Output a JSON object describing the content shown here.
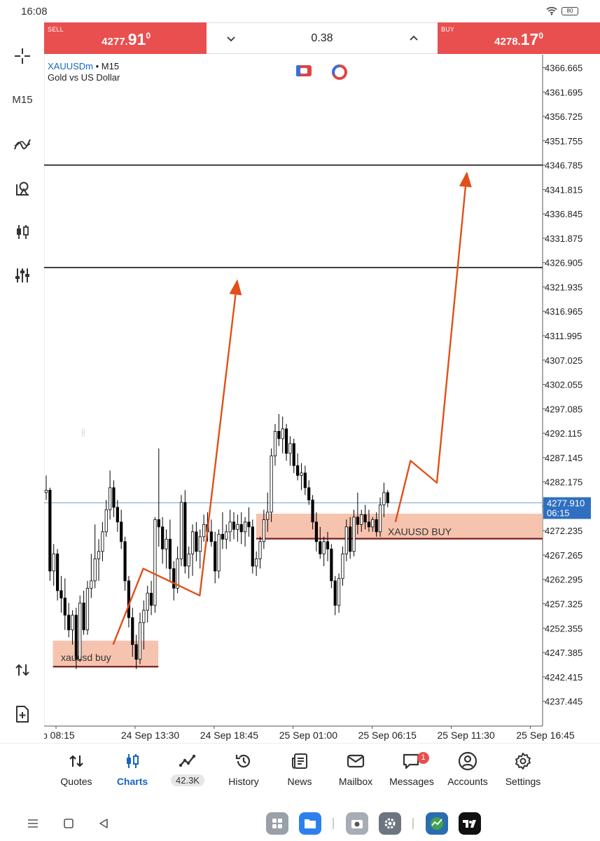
{
  "status_bar": {
    "time": "16:08",
    "battery": "80"
  },
  "trade_panel": {
    "sell": {
      "label": "SELL",
      "price_prefix": "4277.",
      "price_big": "91",
      "price_sup": "0"
    },
    "buy": {
      "label": "BUY",
      "price_prefix": "4278.",
      "price_big": "17",
      "price_sup": "0"
    },
    "lot": "0.38"
  },
  "toolbar": {
    "timeframe": "M15",
    "icons": [
      "crosshair-icon",
      "indicators-icon",
      "objects-icon",
      "chart-type-icon",
      "settings-sliders-icon",
      "trade-arrows-icon",
      "new-order-icon"
    ]
  },
  "chart": {
    "symbol": "XAUUSDm",
    "separator": " • ",
    "timeframe": "M15",
    "description": "Gold vs US Dollar",
    "current_price_label": "4277.910",
    "countdown": "06:15",
    "colors": {
      "bid_line": "#6fa8dc",
      "zone": "#f5b8a0",
      "arrow": "#e0501a",
      "zone_line": "#7a1f1f",
      "bid_label_bg": "#2f6fc0"
    }
  },
  "chart_data": {
    "type": "candlestick",
    "symbol": "XAUUSDm",
    "timeframe": "M15",
    "price_axis": [
      "4366.665",
      "4361.695",
      "4356.725",
      "4351.755",
      "4346.785",
      "4341.815",
      "4336.845",
      "4331.875",
      "4326.905",
      "4321.935",
      "4316.965",
      "4311.995",
      "4307.025",
      "4302.055",
      "4297.085",
      "4292.115",
      "4287.145",
      "4282.175",
      "4277.205",
      "4272.235",
      "4267.265",
      "4262.295",
      "4257.325",
      "4252.355",
      "4247.385",
      "4242.415",
      "4237.445"
    ],
    "time_axis": [
      "p 08:15",
      "24 Sep 13:30",
      "24 Sep 18:45",
      "25 Sep 01:00",
      "25 Sep 06:15",
      "25 Sep 11:30",
      "25 Sep 16:45"
    ],
    "ylim": [
      4234,
      4371
    ],
    "current_bid": 4277.91,
    "horizontal_lines": [
      4346.785,
      4325.9
    ],
    "zones": [
      {
        "label": "xauusd buy",
        "from_time": "24 Sep 08:00",
        "to_time": "24 Sep 15:00",
        "low": 4244.5,
        "high": 4249.8
      },
      {
        "label": "XAUUSD BUY",
        "from_time": "24 Sep 21:30",
        "to_time": "25 Sep 17:30",
        "low": 4270.6,
        "high": 4275.7
      }
    ],
    "projection_arrows": [
      {
        "points": [
          {
            "time": "24 Sep 12:00",
            "price": 4249
          },
          {
            "time": "24 Sep 14:00",
            "price": 4264.5
          },
          {
            "time": "24 Sep 17:45",
            "price": 4259
          },
          {
            "time": "24 Sep 20:15",
            "price": 4323.5
          }
        ]
      },
      {
        "points": [
          {
            "time": "25 Sep 06:45",
            "price": 4274
          },
          {
            "time": "25 Sep 07:45",
            "price": 4286.5
          },
          {
            "time": "25 Sep 09:30",
            "price": 4282
          },
          {
            "time": "25 Sep 11:30",
            "price": 4345.5
          }
        ]
      }
    ],
    "candles": [
      {
        "o": 4280.0,
        "h": 4283.5,
        "l": 4278.5,
        "c": 4280.5
      },
      {
        "o": 4280.5,
        "h": 4281.0,
        "l": 4262.0,
        "c": 4264.0
      },
      {
        "o": 4264.0,
        "h": 4269.5,
        "l": 4261.0,
        "c": 4267.5
      },
      {
        "o": 4267.5,
        "h": 4268.5,
        "l": 4258.0,
        "c": 4260.0
      },
      {
        "o": 4260.0,
        "h": 4263.0,
        "l": 4255.5,
        "c": 4258.5
      },
      {
        "o": 4258.5,
        "h": 4262.5,
        "l": 4252.0,
        "c": 4255.0
      },
      {
        "o": 4255.0,
        "h": 4257.5,
        "l": 4250.5,
        "c": 4252.0
      },
      {
        "o": 4252.0,
        "h": 4256.0,
        "l": 4249.0,
        "c": 4255.0
      },
      {
        "o": 4255.0,
        "h": 4256.5,
        "l": 4244.0,
        "c": 4246.0
      },
      {
        "o": 4246.0,
        "h": 4259.0,
        "l": 4245.5,
        "c": 4257.5
      },
      {
        "o": 4257.5,
        "h": 4260.0,
        "l": 4251.0,
        "c": 4252.0
      },
      {
        "o": 4252.0,
        "h": 4262.0,
        "l": 4251.0,
        "c": 4260.5
      },
      {
        "o": 4260.5,
        "h": 4267.5,
        "l": 4258.5,
        "c": 4262.0
      },
      {
        "o": 4262.0,
        "h": 4273.5,
        "l": 4260.5,
        "c": 4266.5
      },
      {
        "o": 4266.5,
        "h": 4270.5,
        "l": 4262.0,
        "c": 4268.0
      },
      {
        "o": 4268.0,
        "h": 4274.0,
        "l": 4266.0,
        "c": 4272.0
      },
      {
        "o": 4272.0,
        "h": 4278.5,
        "l": 4271.0,
        "c": 4276.5
      },
      {
        "o": 4276.5,
        "h": 4284.5,
        "l": 4274.5,
        "c": 4281.0
      },
      {
        "o": 4281.0,
        "h": 4282.5,
        "l": 4275.0,
        "c": 4277.0
      },
      {
        "o": 4277.0,
        "h": 4278.5,
        "l": 4272.0,
        "c": 4274.0
      },
      {
        "o": 4274.0,
        "h": 4276.5,
        "l": 4268.5,
        "c": 4270.0
      },
      {
        "o": 4270.0,
        "h": 4271.0,
        "l": 4260.0,
        "c": 4262.0
      },
      {
        "o": 4262.0,
        "h": 4263.0,
        "l": 4252.5,
        "c": 4254.5
      },
      {
        "o": 4254.5,
        "h": 4256.5,
        "l": 4246.5,
        "c": 4249.0
      },
      {
        "o": 4249.0,
        "h": 4251.0,
        "l": 4244.0,
        "c": 4246.0
      },
      {
        "o": 4246.0,
        "h": 4255.5,
        "l": 4245.0,
        "c": 4253.5
      },
      {
        "o": 4253.5,
        "h": 4258.0,
        "l": 4248.0,
        "c": 4256.0
      },
      {
        "o": 4256.0,
        "h": 4261.0,
        "l": 4253.5,
        "c": 4259.5
      },
      {
        "o": 4259.5,
        "h": 4262.0,
        "l": 4255.0,
        "c": 4257.0
      },
      {
        "o": 4257.0,
        "h": 4275.0,
        "l": 4255.5,
        "c": 4274.5
      },
      {
        "o": 4274.5,
        "h": 4289.0,
        "l": 4269.0,
        "c": 4273.0
      },
      {
        "o": 4273.0,
        "h": 4275.0,
        "l": 4265.5,
        "c": 4268.5
      },
      {
        "o": 4268.5,
        "h": 4272.5,
        "l": 4264.5,
        "c": 4270.5
      },
      {
        "o": 4270.5,
        "h": 4274.5,
        "l": 4262.0,
        "c": 4264.5
      },
      {
        "o": 4264.5,
        "h": 4266.0,
        "l": 4258.0,
        "c": 4260.5
      },
      {
        "o": 4260.5,
        "h": 4269.0,
        "l": 4259.5,
        "c": 4266.5
      },
      {
        "o": 4266.5,
        "h": 4279.5,
        "l": 4265.0,
        "c": 4278.0
      },
      {
        "o": 4278.0,
        "h": 4280.5,
        "l": 4263.5,
        "c": 4265.0
      },
      {
        "o": 4265.0,
        "h": 4269.0,
        "l": 4262.5,
        "c": 4267.5
      },
      {
        "o": 4267.5,
        "h": 4273.5,
        "l": 4263.0,
        "c": 4272.0
      },
      {
        "o": 4272.0,
        "h": 4274.0,
        "l": 4266.0,
        "c": 4268.0
      },
      {
        "o": 4268.0,
        "h": 4272.5,
        "l": 4264.5,
        "c": 4271.0
      },
      {
        "o": 4271.0,
        "h": 4275.5,
        "l": 4270.0,
        "c": 4273.5
      },
      {
        "o": 4273.5,
        "h": 4276.0,
        "l": 4270.0,
        "c": 4272.0
      },
      {
        "o": 4272.0,
        "h": 4274.5,
        "l": 4269.0,
        "c": 4270.0
      },
      {
        "o": 4270.0,
        "h": 4272.0,
        "l": 4261.5,
        "c": 4264.0
      },
      {
        "o": 4264.0,
        "h": 4272.5,
        "l": 4262.5,
        "c": 4271.5
      },
      {
        "o": 4271.5,
        "h": 4276.0,
        "l": 4268.5,
        "c": 4270.5
      },
      {
        "o": 4270.5,
        "h": 4273.5,
        "l": 4268.5,
        "c": 4272.0
      },
      {
        "o": 4272.0,
        "h": 4276.5,
        "l": 4270.0,
        "c": 4274.0
      },
      {
        "o": 4274.0,
        "h": 4276.0,
        "l": 4270.5,
        "c": 4272.5
      },
      {
        "o": 4272.5,
        "h": 4275.5,
        "l": 4270.0,
        "c": 4273.5
      },
      {
        "o": 4273.5,
        "h": 4276.0,
        "l": 4269.5,
        "c": 4272.0
      },
      {
        "o": 4272.0,
        "h": 4275.0,
        "l": 4269.0,
        "c": 4274.0
      },
      {
        "o": 4274.0,
        "h": 4277.0,
        "l": 4271.0,
        "c": 4273.0
      },
      {
        "o": 4273.0,
        "h": 4274.5,
        "l": 4263.5,
        "c": 4265.0
      },
      {
        "o": 4265.0,
        "h": 4268.0,
        "l": 4263.0,
        "c": 4266.5
      },
      {
        "o": 4266.5,
        "h": 4271.0,
        "l": 4264.5,
        "c": 4270.0
      },
      {
        "o": 4270.0,
        "h": 4276.5,
        "l": 4268.5,
        "c": 4274.5
      },
      {
        "o": 4274.5,
        "h": 4280.0,
        "l": 4272.0,
        "c": 4276.0
      },
      {
        "o": 4276.0,
        "h": 4289.0,
        "l": 4274.0,
        "c": 4287.5
      },
      {
        "o": 4287.5,
        "h": 4294.0,
        "l": 4285.5,
        "c": 4292.5
      },
      {
        "o": 4292.5,
        "h": 4296.0,
        "l": 4289.5,
        "c": 4291.0
      },
      {
        "o": 4291.0,
        "h": 4295.5,
        "l": 4288.0,
        "c": 4293.0
      },
      {
        "o": 4293.0,
        "h": 4294.0,
        "l": 4286.5,
        "c": 4288.0
      },
      {
        "o": 4288.0,
        "h": 4291.5,
        "l": 4285.5,
        "c": 4290.0
      },
      {
        "o": 4290.0,
        "h": 4291.0,
        "l": 4284.0,
        "c": 4285.5
      },
      {
        "o": 4285.5,
        "h": 4288.0,
        "l": 4282.5,
        "c": 4283.5
      },
      {
        "o": 4283.5,
        "h": 4286.0,
        "l": 4280.5,
        "c": 4284.0
      },
      {
        "o": 4284.0,
        "h": 4285.5,
        "l": 4279.5,
        "c": 4281.0
      },
      {
        "o": 4281.0,
        "h": 4282.5,
        "l": 4277.5,
        "c": 4278.5
      },
      {
        "o": 4278.5,
        "h": 4279.5,
        "l": 4272.5,
        "c": 4274.0
      },
      {
        "o": 4274.0,
        "h": 4276.0,
        "l": 4268.0,
        "c": 4270.0
      },
      {
        "o": 4270.0,
        "h": 4273.0,
        "l": 4266.5,
        "c": 4267.5
      },
      {
        "o": 4267.5,
        "h": 4271.0,
        "l": 4265.0,
        "c": 4270.0
      },
      {
        "o": 4270.0,
        "h": 4272.0,
        "l": 4266.0,
        "c": 4268.5
      },
      {
        "o": 4268.5,
        "h": 4269.5,
        "l": 4260.5,
        "c": 4262.0
      },
      {
        "o": 4262.0,
        "h": 4263.0,
        "l": 4255.0,
        "c": 4257.0
      },
      {
        "o": 4257.0,
        "h": 4263.5,
        "l": 4255.5,
        "c": 4262.5
      },
      {
        "o": 4262.5,
        "h": 4269.0,
        "l": 4261.0,
        "c": 4267.5
      },
      {
        "o": 4267.5,
        "h": 4274.5,
        "l": 4266.0,
        "c": 4273.0
      },
      {
        "o": 4273.0,
        "h": 4275.0,
        "l": 4266.5,
        "c": 4268.0
      },
      {
        "o": 4268.0,
        "h": 4276.5,
        "l": 4267.0,
        "c": 4275.0
      },
      {
        "o": 4275.0,
        "h": 4280.0,
        "l": 4271.5,
        "c": 4273.5
      },
      {
        "o": 4273.5,
        "h": 4276.5,
        "l": 4272.0,
        "c": 4275.5
      },
      {
        "o": 4275.5,
        "h": 4277.5,
        "l": 4272.5,
        "c": 4274.0
      },
      {
        "o": 4274.0,
        "h": 4276.5,
        "l": 4272.0,
        "c": 4273.0
      },
      {
        "o": 4273.0,
        "h": 4275.0,
        "l": 4272.0,
        "c": 4274.5
      },
      {
        "o": 4274.5,
        "h": 4276.0,
        "l": 4271.0,
        "c": 4272.0
      },
      {
        "o": 4272.0,
        "h": 4279.0,
        "l": 4271.0,
        "c": 4277.5
      },
      {
        "o": 4277.5,
        "h": 4282.0,
        "l": 4275.0,
        "c": 4280.0
      },
      {
        "o": 4280.0,
        "h": 4280.5,
        "l": 4277.0,
        "c": 4277.9
      }
    ]
  },
  "bottom_nav": [
    {
      "label": "Quotes",
      "icon": "quotes-icon"
    },
    {
      "label": "Charts",
      "icon": "charts-icon",
      "active": true
    },
    {
      "label": "42.3K",
      "icon": "trade-line-icon",
      "pill": true
    },
    {
      "label": "History",
      "icon": "history-icon"
    },
    {
      "label": "News",
      "icon": "news-icon"
    },
    {
      "label": "Mailbox",
      "icon": "mailbox-icon"
    },
    {
      "label": "Messages",
      "icon": "messages-icon",
      "badge": "1"
    },
    {
      "label": "Accounts",
      "icon": "accounts-icon"
    },
    {
      "label": "Settings",
      "icon": "settings-icon"
    }
  ]
}
